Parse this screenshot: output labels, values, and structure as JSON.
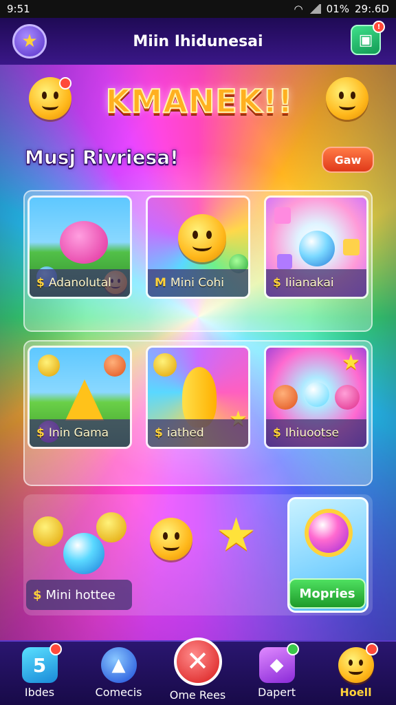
{
  "status_bar": {
    "time": "9:51",
    "battery": "01%",
    "right_text": "29:.6D"
  },
  "header": {
    "title": "Miin Ihidunesai",
    "gift_badge": "!"
  },
  "banner": {
    "title": "KMANEK!!"
  },
  "section": {
    "title": "Musj Rivriesa!",
    "button_label": "Gaw"
  },
  "cards_row1": [
    {
      "label": "Adanolutal",
      "currency": "$"
    },
    {
      "label": "Mini Cohi",
      "currency": "M"
    },
    {
      "label": "Iiianakai",
      "currency": "$"
    }
  ],
  "cards_row2": [
    {
      "label": "Inin Gama",
      "currency": "$"
    },
    {
      "label": "iathed",
      "currency": "$"
    },
    {
      "label": "Ihiuootse",
      "currency": "$"
    }
  ],
  "bottom_section": {
    "label": "Mini hottee",
    "currency": "$",
    "button_label": "Mopries"
  },
  "nav": {
    "items": [
      {
        "label": "Ibdes",
        "icon": "block-icon"
      },
      {
        "label": "Comecis",
        "icon": "arrow-icon"
      },
      {
        "label": "Ome Rees",
        "icon": "close-icon"
      },
      {
        "label": "Dapert",
        "icon": "gift-icon"
      },
      {
        "label": "Hoell",
        "icon": "smiley-icon"
      }
    ]
  },
  "colors": {
    "accent": "#ffd23a",
    "header_bg": "#2a1670",
    "button_orange": "#e03a1a",
    "button_green": "#1e9a2a"
  }
}
